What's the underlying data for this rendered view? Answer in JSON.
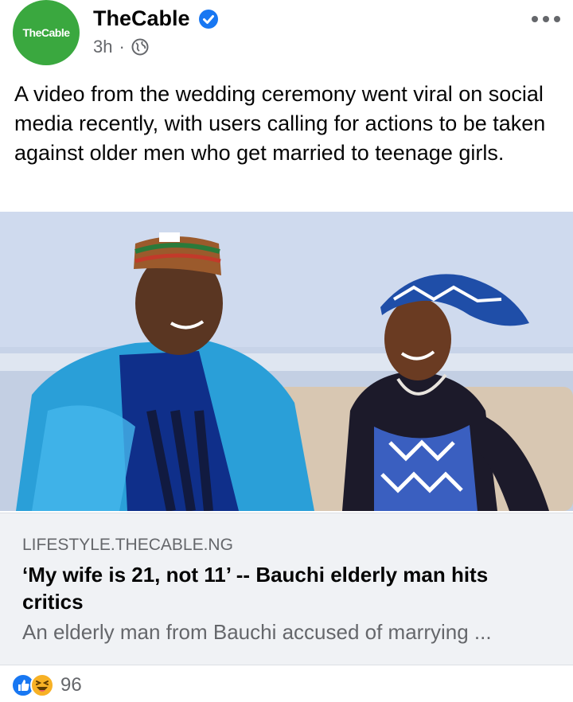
{
  "header": {
    "avatar_text": "TheCable",
    "page_name": "TheCable",
    "time": "3h",
    "separator": "·",
    "privacy_icon": "globe-icon",
    "verified_icon": "verified-badge-icon",
    "more_icon": "more-options-icon"
  },
  "post": {
    "text": "A video from the wedding ceremony went viral on social media recently, with users calling for actions to be taken against older men who get married to teenage girls."
  },
  "link_preview": {
    "domain": "LIFESTYLE.THECABLE.NG",
    "title": "‘My wife is 21, not 11’ -- Bauchi elderly man hits critics",
    "description": "An elderly man from Bauchi accused of marrying ..."
  },
  "reactions": {
    "icons": [
      "like-icon",
      "haha-icon"
    ],
    "count": "96"
  },
  "colors": {
    "brand_green": "#3aa83f",
    "facebook_blue": "#1877f2",
    "secondary_text": "#65676b",
    "card_bg": "#f0f2f5"
  }
}
